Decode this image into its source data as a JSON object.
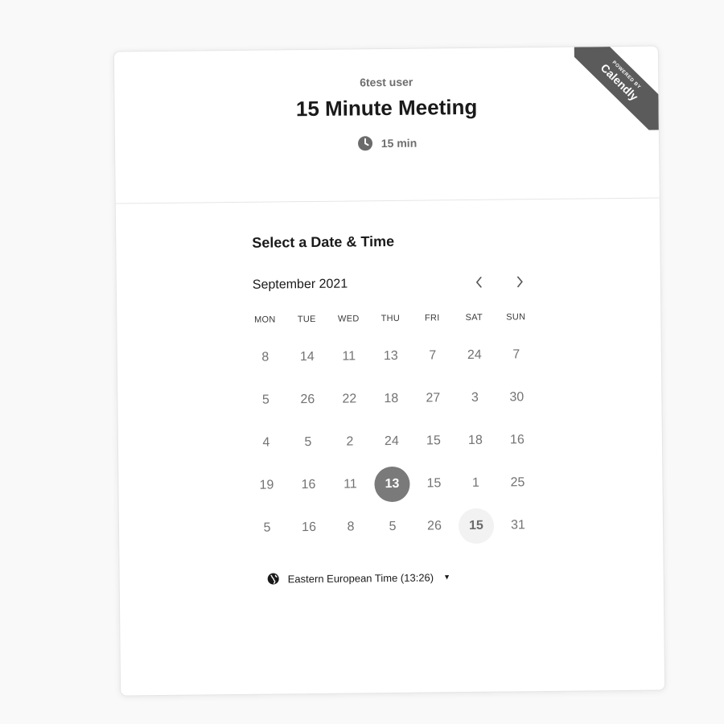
{
  "ribbon": {
    "powered_by": "POWERED BY",
    "brand": "Calendly"
  },
  "header": {
    "organizer": "6test user",
    "title": "15 Minute Meeting",
    "duration": "15 min"
  },
  "picker": {
    "heading": "Select a Date & Time",
    "month": "September 2021",
    "prev_icon": "chevron-left-icon",
    "next_icon": "chevron-right-icon"
  },
  "calendar": {
    "days_of_week": [
      "MON",
      "TUE",
      "WED",
      "THU",
      "FRI",
      "SAT",
      "SUN"
    ],
    "weeks": [
      [
        "8",
        "14",
        "11",
        "13",
        "7",
        "24",
        "7"
      ],
      [
        "5",
        "26",
        "22",
        "18",
        "27",
        "3",
        "30"
      ],
      [
        "4",
        "5",
        "2",
        "24",
        "15",
        "18",
        "16"
      ],
      [
        "19",
        "16",
        "11",
        "13",
        "15",
        "1",
        "25"
      ],
      [
        "5",
        "16",
        "8",
        "5",
        "26",
        "15",
        "31"
      ]
    ],
    "selected": {
      "week": 3,
      "day": 3
    },
    "today": {
      "week": 4,
      "day": 5
    }
  },
  "timezone": {
    "label": "Eastern European Time (13:26)",
    "icon": "globe-icon"
  },
  "colors": {
    "selected_day": "#7a7a7a",
    "ribbon": "#5b5b5b"
  }
}
